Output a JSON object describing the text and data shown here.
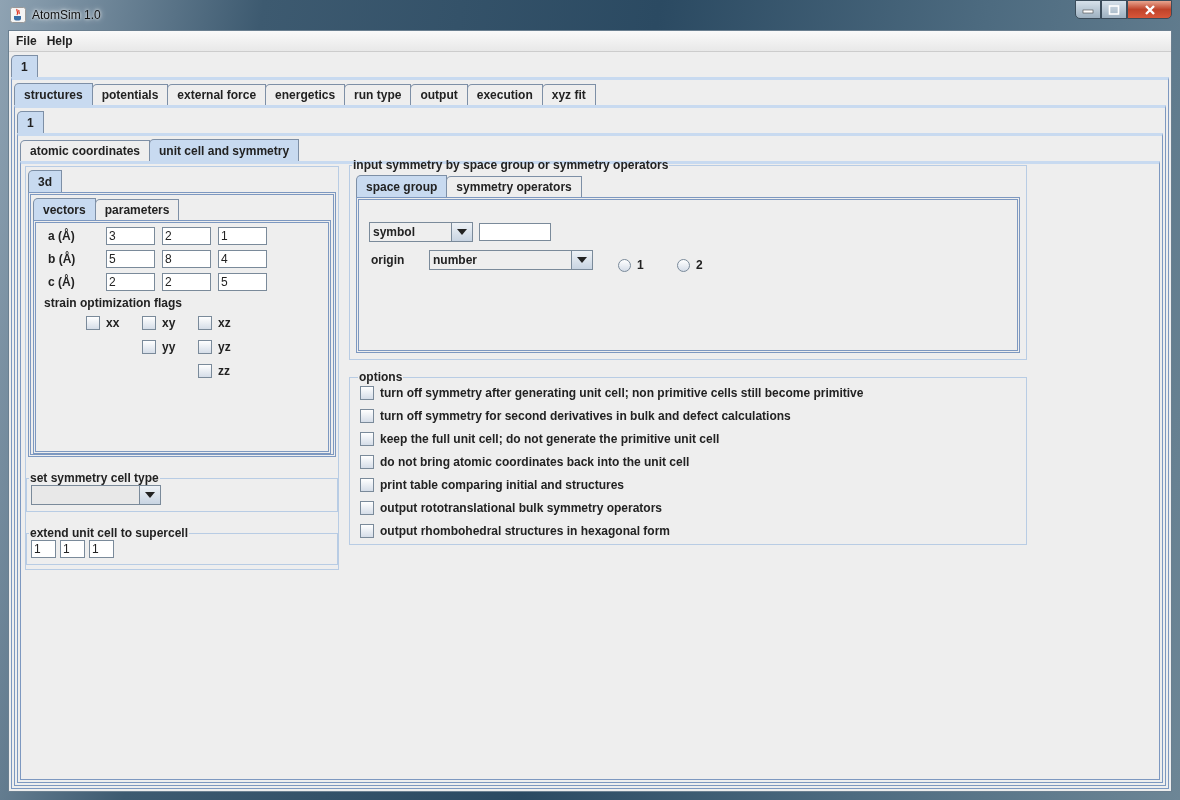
{
  "window": {
    "title": "AtomSim 1.0"
  },
  "menu": [
    "File",
    "Help"
  ],
  "outer_tabs": [
    {
      "label": "1",
      "selected": true
    }
  ],
  "main_tabs": [
    {
      "label": "structures",
      "selected": true
    },
    {
      "label": "potentials",
      "selected": false
    },
    {
      "label": "external force",
      "selected": false
    },
    {
      "label": "energetics",
      "selected": false
    },
    {
      "label": "run type",
      "selected": false
    },
    {
      "label": "output",
      "selected": false
    },
    {
      "label": "execution",
      "selected": false
    },
    {
      "label": "xyz fit",
      "selected": false
    }
  ],
  "inner_tabs": [
    {
      "label": "1",
      "selected": true
    }
  ],
  "sub_tabs": [
    {
      "label": "atomic coordinates",
      "selected": false
    },
    {
      "label": "unit cell and symmetry",
      "selected": true
    }
  ],
  "dimension_tabs": [
    {
      "label": "3d",
      "selected": true
    }
  ],
  "vector_tabs": [
    {
      "label": "vectors",
      "selected": true
    },
    {
      "label": "parameters",
      "selected": false
    }
  ],
  "vectors": [
    {
      "label": "a (Å)",
      "values": [
        "3",
        "2",
        "1"
      ]
    },
    {
      "label": "b (Å)",
      "values": [
        "5",
        "8",
        "4"
      ]
    },
    {
      "label": "c (Å)",
      "values": [
        "2",
        "2",
        "5"
      ]
    }
  ],
  "strain_flags": {
    "title": "strain optimization flags",
    "rows": [
      [
        {
          "label": "xx",
          "checked": false
        },
        {
          "label": "xy",
          "checked": false
        },
        {
          "label": "xz",
          "checked": false
        }
      ],
      [
        null,
        {
          "label": "yy",
          "checked": false
        },
        {
          "label": "yz",
          "checked": false
        }
      ],
      [
        null,
        null,
        {
          "label": "zz",
          "checked": false
        }
      ]
    ]
  },
  "symmetry_cell_type": {
    "title": "set symmetry cell type"
  },
  "supercell": {
    "title": "extend unit cell to supercell",
    "values": [
      "1",
      "1",
      "1"
    ]
  },
  "input_symmetry": {
    "title": "input symmetry by space group or symmetry operators",
    "tabs": [
      {
        "label": "space group",
        "selected": true
      },
      {
        "label": "symmetry operators",
        "selected": false
      }
    ],
    "symbol_dropdown": "symbol",
    "origin_label": "origin",
    "origin_dropdown": "number",
    "origin_radios": [
      {
        "label": "1",
        "selected": false
      },
      {
        "label": "2",
        "selected": false
      }
    ]
  },
  "options": {
    "title": "options",
    "items": [
      {
        "label": "turn off symmetry after generating unit cell; non primitive cells still become primitive",
        "checked": false
      },
      {
        "label": "turn off symmetry for second derivatives in bulk and defect calculations",
        "checked": false
      },
      {
        "label": "keep the full unit cell; do not generate the primitive unit cell",
        "checked": false
      },
      {
        "label": "do not bring atomic coordinates back into the unit cell",
        "checked": false
      },
      {
        "label": "print table comparing initial and structures",
        "checked": false
      },
      {
        "label": "output rototranslational bulk symmetry operators",
        "checked": false
      },
      {
        "label": "output rhombohedral structures in hexagonal form",
        "checked": false
      }
    ]
  }
}
